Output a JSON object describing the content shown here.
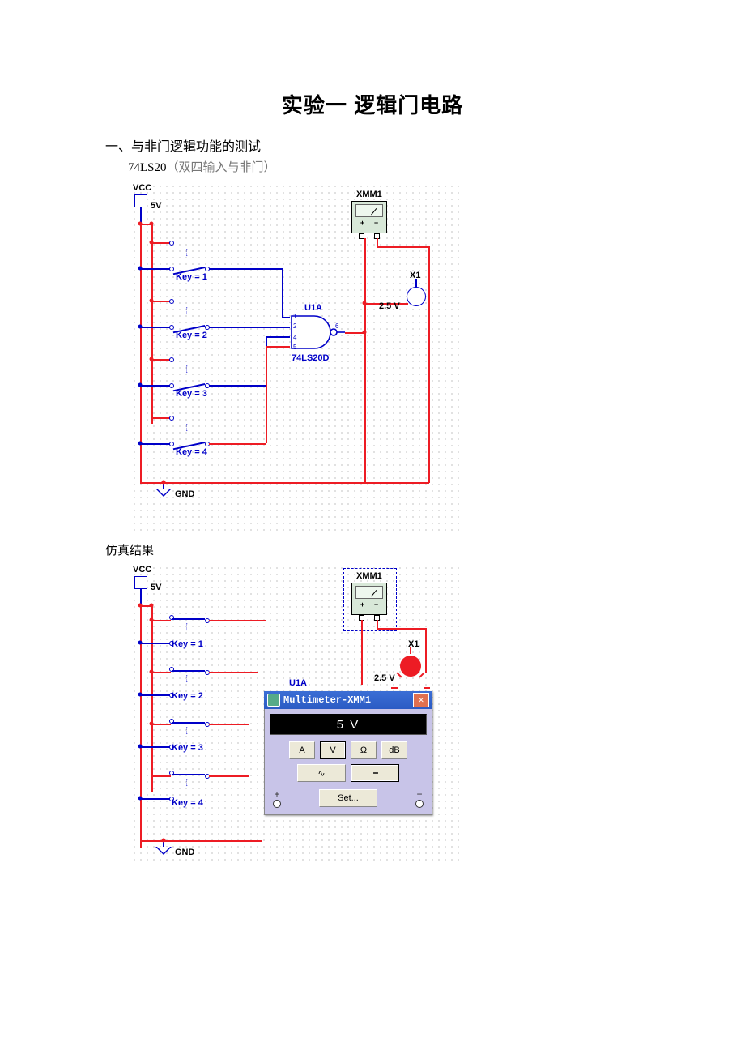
{
  "title": "实验一  逻辑门电路",
  "section1": {
    "heading": "一、与非门逻辑功能的测试",
    "chip_line_prefix": "74LS20",
    "chip_line_note": "（双四输入与非门）"
  },
  "result_label": "仿真结果",
  "vcc": {
    "label": "VCC",
    "voltage": "5V"
  },
  "gnd": {
    "label": "GND"
  },
  "switches": {
    "k1": "Key = 1",
    "k2": "Key = 2",
    "k3": "Key = 3",
    "k4": "Key = 4"
  },
  "gate": {
    "ref": "U1A",
    "part": "74LS20D",
    "pins": {
      "a": "1",
      "b": "2",
      "c": "4",
      "d": "5",
      "y": "6"
    }
  },
  "xmm": {
    "label": "XMM1",
    "plus": "+",
    "minus": "−"
  },
  "indicator": {
    "label": "X1",
    "voltage": "2.5 V"
  },
  "multimeter": {
    "title": "Multimeter-XMM1",
    "reading": "5 V",
    "buttons": {
      "A": "A",
      "V": "V",
      "O": "Ω",
      "dB": "dB"
    },
    "wave_ac": "∿",
    "wave_dc": "⎯",
    "set": "Set...",
    "plus": "+",
    "minus": "−"
  }
}
